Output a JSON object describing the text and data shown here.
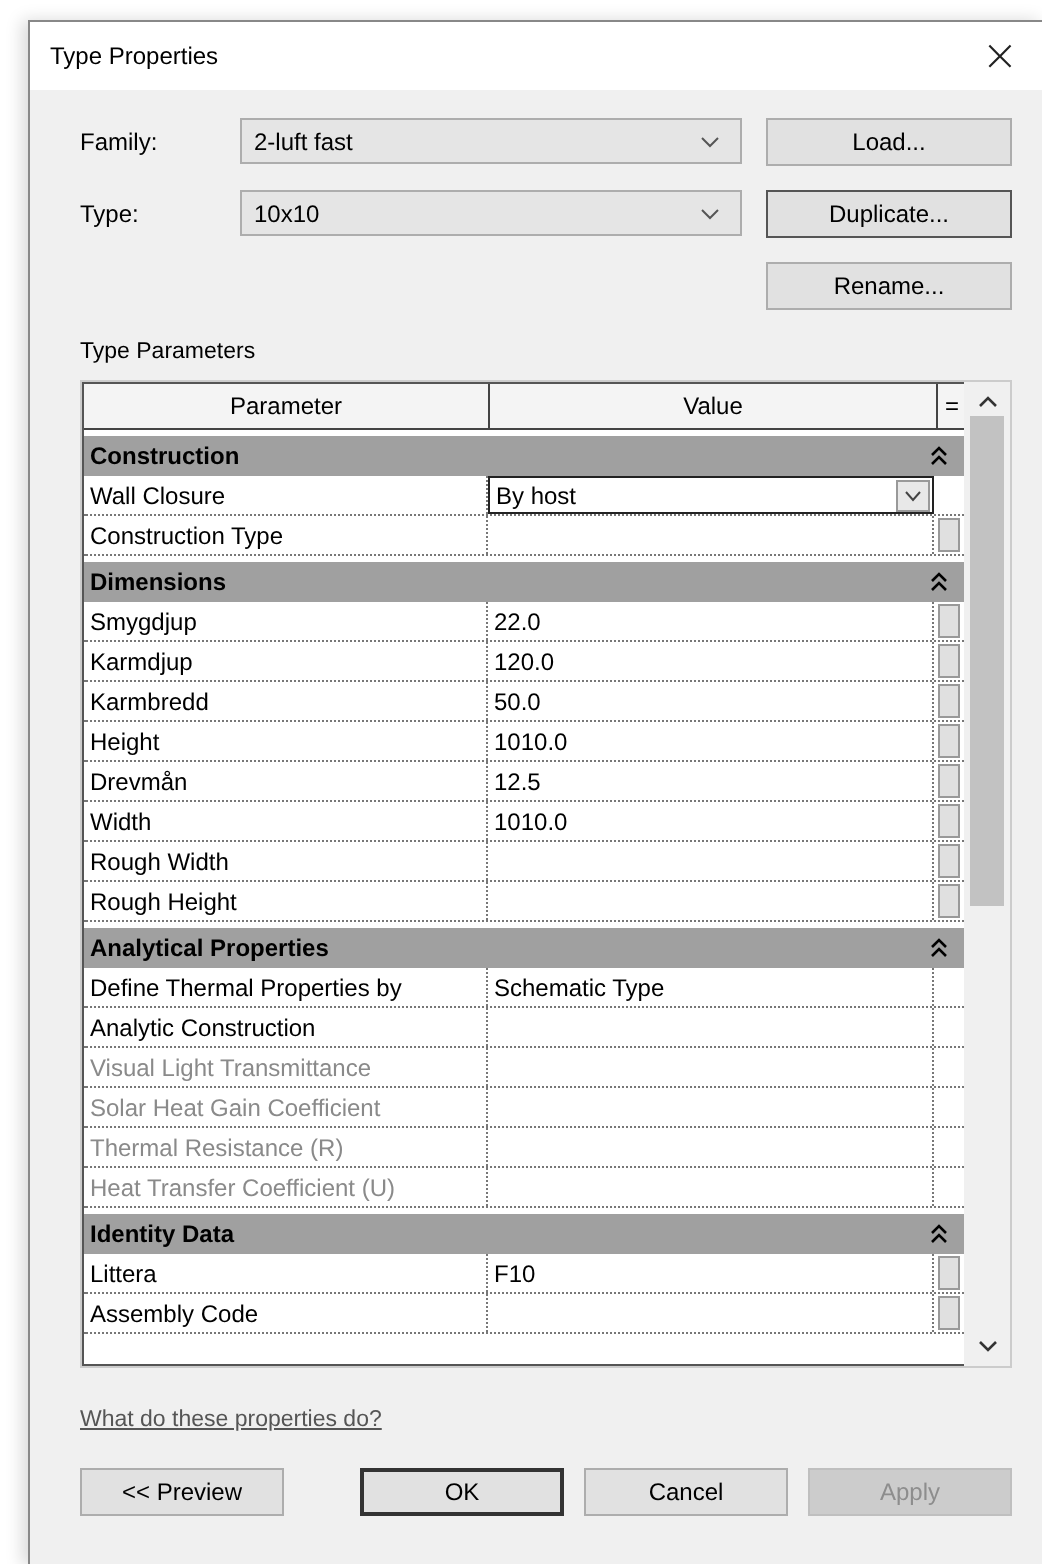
{
  "window": {
    "title": "Type Properties",
    "close": "×"
  },
  "fields": [
    {
      "label": "Family:",
      "value": "2-luft fast"
    },
    {
      "label": "Type:",
      "value": "10x10"
    }
  ],
  "side_buttons": [
    "Load...",
    "Duplicate...",
    "Rename..."
  ],
  "group_label": "Type Parameters",
  "table": {
    "columns": [
      "Parameter",
      "Value",
      "="
    ],
    "sections": [
      {
        "name": "Construction",
        "expanded": true,
        "rows": [
          {
            "name": "Wall Closure",
            "value": "By host",
            "kind": "combo",
            "disabled": false
          },
          {
            "name": "Construction Type",
            "kind": "param",
            "disabled": false
          }
        ]
      },
      {
        "name": "Dimensions",
        "expanded": true,
        "rows": [
          {
            "name": "Smygdjup",
            "value": "22.0",
            "kind": "param",
            "disabled": false
          },
          {
            "name": "Karmdjup",
            "value": "120.0",
            "kind": "param",
            "disabled": false
          },
          {
            "name": "Karmbredd",
            "value": "50.0",
            "kind": "param",
            "disabled": false
          },
          {
            "name": "Height",
            "value": "1010.0",
            "kind": "param",
            "disabled": false
          },
          {
            "name": "Drevmån",
            "value": "12.5",
            "kind": "param",
            "disabled": false
          },
          {
            "name": "Width",
            "value": "1010.0",
            "kind": "param",
            "disabled": false
          },
          {
            "name": "Rough Width",
            "kind": "param",
            "disabled": false
          },
          {
            "name": "Rough Height",
            "kind": "param",
            "disabled": false
          }
        ]
      },
      {
        "name": "Analytical Properties",
        "expanded": true,
        "rows": [
          {
            "name": "Define Thermal Properties by",
            "value": "Schematic Type",
            "kind": "plain",
            "disabled": false
          },
          {
            "name": "Analytic Construction",
            "kind": "plain",
            "disabled": false
          },
          {
            "name": "Visual Light Transmittance",
            "kind": "plain",
            "disabled": true
          },
          {
            "name": "Solar Heat Gain Coefficient",
            "kind": "plain",
            "disabled": true
          },
          {
            "name": "Thermal Resistance (R)",
            "kind": "plain",
            "disabled": true
          },
          {
            "name": "Heat Transfer Coefficient (U)",
            "kind": "plain",
            "disabled": true
          }
        ]
      },
      {
        "name": "Identity Data",
        "expanded": true,
        "rows": [
          {
            "name": "Littera",
            "value": "F10",
            "kind": "param",
            "disabled": false
          },
          {
            "name": "Assembly Code",
            "kind": "param",
            "disabled": false
          }
        ]
      }
    ]
  },
  "help_link": "What do these properties do?",
  "buttons": [
    {
      "label": "<< Preview",
      "default": false,
      "disabled": false
    },
    {
      "label": "OK",
      "default": true,
      "disabled": false
    },
    {
      "label": "Cancel",
      "default": false,
      "disabled": false
    },
    {
      "label": "Apply",
      "default": false,
      "disabled": true
    }
  ]
}
